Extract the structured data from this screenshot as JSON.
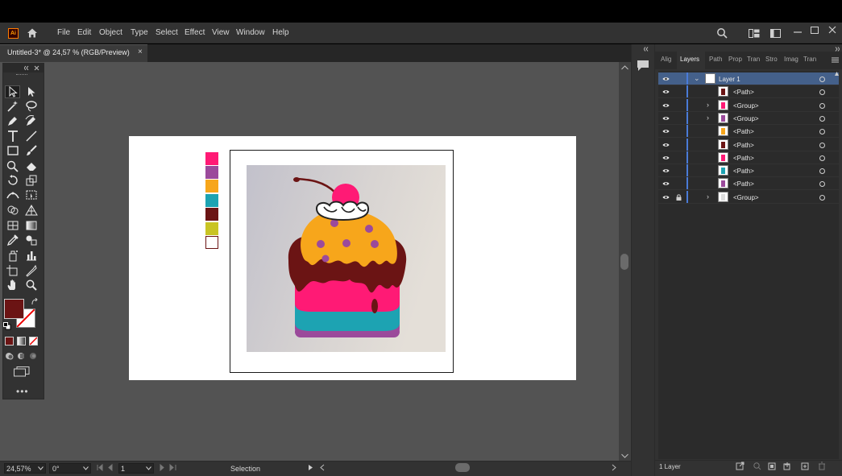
{
  "app": {
    "logo_text": "Ai",
    "menu": [
      "File",
      "Edit",
      "Object",
      "Type",
      "Select",
      "Effect",
      "View",
      "Window",
      "Help"
    ]
  },
  "document": {
    "tab_title": "Untitled-3* @ 24,57 % (RGB/Preview)",
    "tab_close": "×"
  },
  "colors": {
    "accent_selection": "#44608a",
    "layer_color": "#4a7bd8",
    "fill_color": "#6b1414"
  },
  "swatches": [
    "#ff1a75",
    "#9b4a9b",
    "#f7a61b",
    "#1da3b2",
    "#6b1414",
    "#c9c424",
    "#ffffff"
  ],
  "status": {
    "zoom": "24,57%",
    "rotation": "0°",
    "artboard_num": "1",
    "tool_name": "Selection"
  },
  "panel": {
    "tabs": [
      "Alig",
      "Layers",
      "Path",
      "Prop",
      "Tran",
      "Stro",
      "Imag",
      "Tran"
    ],
    "active_tab": "Layers",
    "layers": [
      {
        "name": "Layer 1",
        "selected": true,
        "expand": "open",
        "locked": false,
        "thumb": "#ffffff"
      },
      {
        "name": "<Path>",
        "selected": false,
        "expand": "",
        "locked": false,
        "thumb": "#6b1414"
      },
      {
        "name": "<Group>",
        "selected": false,
        "expand": "closed",
        "locked": false,
        "thumb": "#ff1a75"
      },
      {
        "name": "<Group>",
        "selected": false,
        "expand": "closed",
        "locked": false,
        "thumb": "#9b4a9b"
      },
      {
        "name": "<Path>",
        "selected": false,
        "expand": "",
        "locked": false,
        "thumb": "#f7a61b"
      },
      {
        "name": "<Path>",
        "selected": false,
        "expand": "",
        "locked": false,
        "thumb": "#6b1414"
      },
      {
        "name": "<Path>",
        "selected": false,
        "expand": "",
        "locked": false,
        "thumb": "#ff1a75"
      },
      {
        "name": "<Path>",
        "selected": false,
        "expand": "",
        "locked": false,
        "thumb": "#1da3b2"
      },
      {
        "name": "<Path>",
        "selected": false,
        "expand": "",
        "locked": false,
        "thumb": "#9b4a9b"
      },
      {
        "name": "<Group>",
        "selected": false,
        "expand": "closed",
        "locked": true,
        "thumb": "#dddddd"
      }
    ],
    "footer_label": "1 Layer"
  }
}
